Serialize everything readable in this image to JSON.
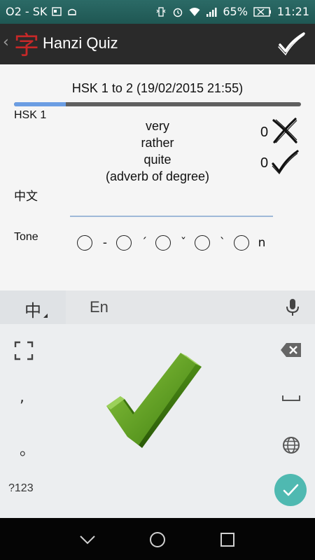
{
  "status_bar": {
    "carrier": "O2 - SK",
    "battery_percent": "65%",
    "time": "11:21",
    "icons": [
      "notification-icon",
      "android-icon",
      "vibrate-icon",
      "alarm-icon",
      "wifi-icon",
      "signal-icon",
      "battery-icon"
    ]
  },
  "action_bar": {
    "title": "Hanzi Quiz",
    "logo_glyph": "字",
    "back_glyph": "‹",
    "confirm_icon": "checkmark-icon"
  },
  "quiz": {
    "title": "HSK 1 to 2 (19/02/2015 21:55)",
    "progress_fraction": 0.18,
    "level": "HSK 1",
    "meanings": [
      "very",
      "rather",
      "quite",
      "(adverb of degree)"
    ],
    "wrong_count": "0",
    "right_count": "0",
    "hanzi_label": "中文",
    "hanzi_input_value": "",
    "tone_label": "Tone",
    "tones": [
      "-",
      "´",
      "ˇ",
      "`",
      "n"
    ]
  },
  "keyboard": {
    "lang_primary": "中",
    "lang_secondary": "En",
    "comma": ",",
    "period": "。",
    "numbers_key": "?123",
    "enter_color": "#4fb9b1"
  },
  "overlay": {
    "result_icon": "big-check-icon",
    "result_color": "#4c8a14"
  },
  "nav_bar": {
    "buttons": [
      "back-nav-icon",
      "home-nav-icon",
      "recents-nav-icon"
    ]
  }
}
